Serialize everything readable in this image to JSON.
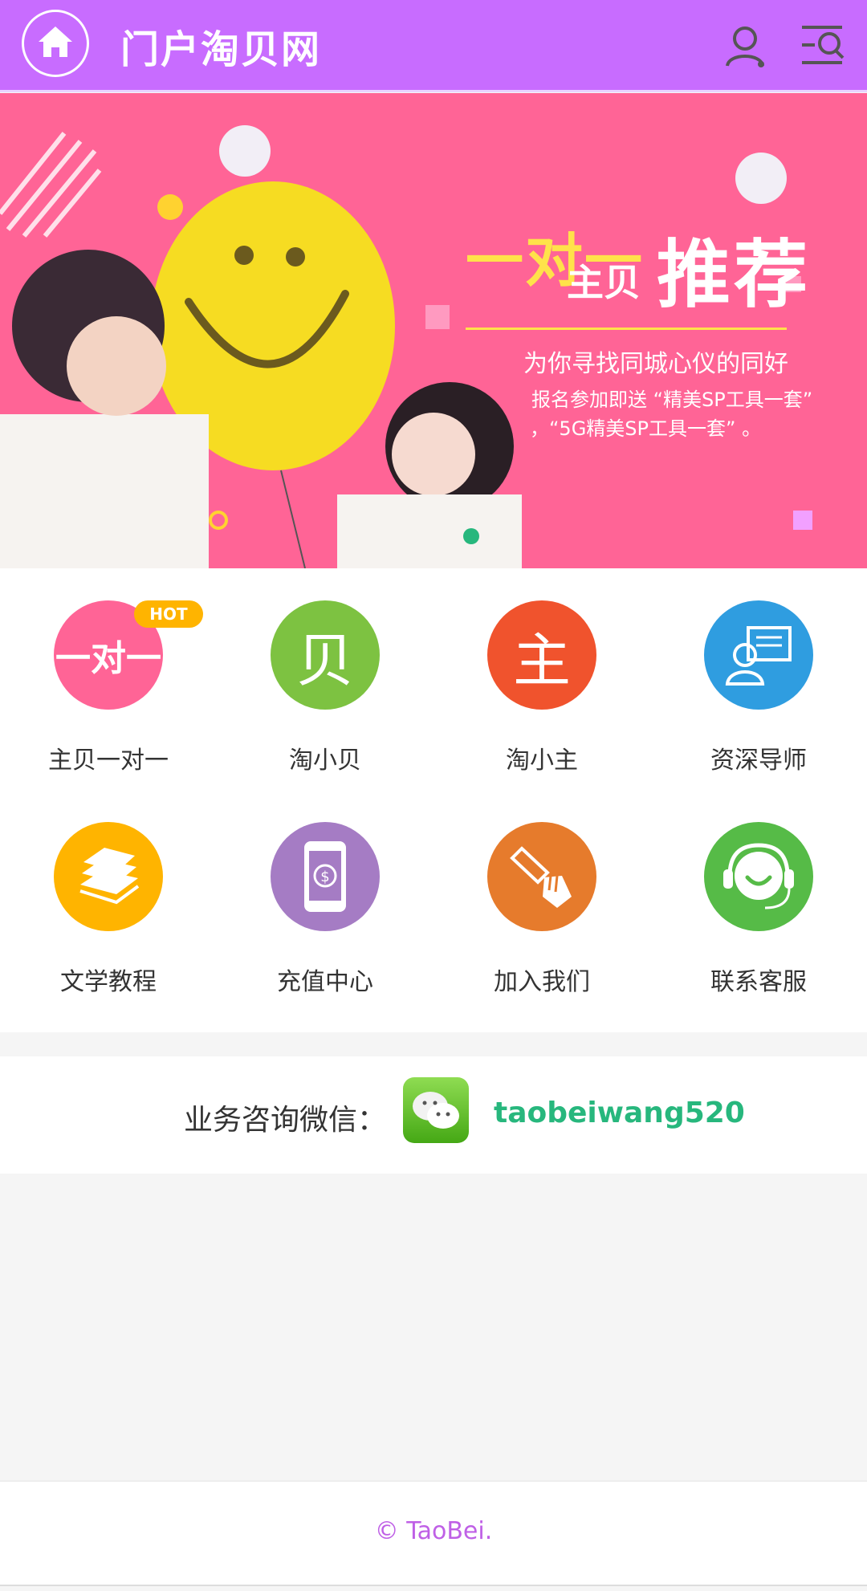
{
  "header": {
    "title": "门户淘贝网",
    "home_icon": "home-icon",
    "user_icon": "user-icon",
    "menu_icon": "menu-search-icon",
    "bg_color": "#c86cff"
  },
  "banner": {
    "line1": "一对一",
    "line2": "主贝",
    "line3": "推荐",
    "subtitle": "为你寻找同城心仪的同好",
    "promo1": "报名参加即送 “精美SP工具一套”",
    "promo2": "，“5G精美SP工具一套” 。",
    "bg_color": "#ff6496"
  },
  "grid": {
    "items": [
      {
        "label": "主贝一对一",
        "icon": "one-on-one-icon",
        "glyph": "一对一",
        "color": "#ff6496",
        "badge": "HOT"
      },
      {
        "label": "淘小贝",
        "icon": "bei-icon",
        "glyph": "贝",
        "color": "#7dc241"
      },
      {
        "label": "淘小主",
        "icon": "zhu-icon",
        "glyph": "主",
        "color": "#f0532d"
      },
      {
        "label": "资深导师",
        "icon": "mentor-icon",
        "color": "#2f9de0"
      },
      {
        "label": "文学教程",
        "icon": "books-icon",
        "color": "#ffb400"
      },
      {
        "label": "充值中心",
        "icon": "phone-dollar-icon",
        "color": "#a57cc4"
      },
      {
        "label": "加入我们",
        "icon": "handshake-icon",
        "color": "#e67b2c"
      },
      {
        "label": "联系客服",
        "icon": "headset-icon",
        "color": "#56bb47"
      }
    ]
  },
  "consult": {
    "label": "业务咨询微信：",
    "wechat_id": "taobeiwang520",
    "icon": "wechat-icon"
  },
  "footer": {
    "copyright": "© TaoBei."
  }
}
